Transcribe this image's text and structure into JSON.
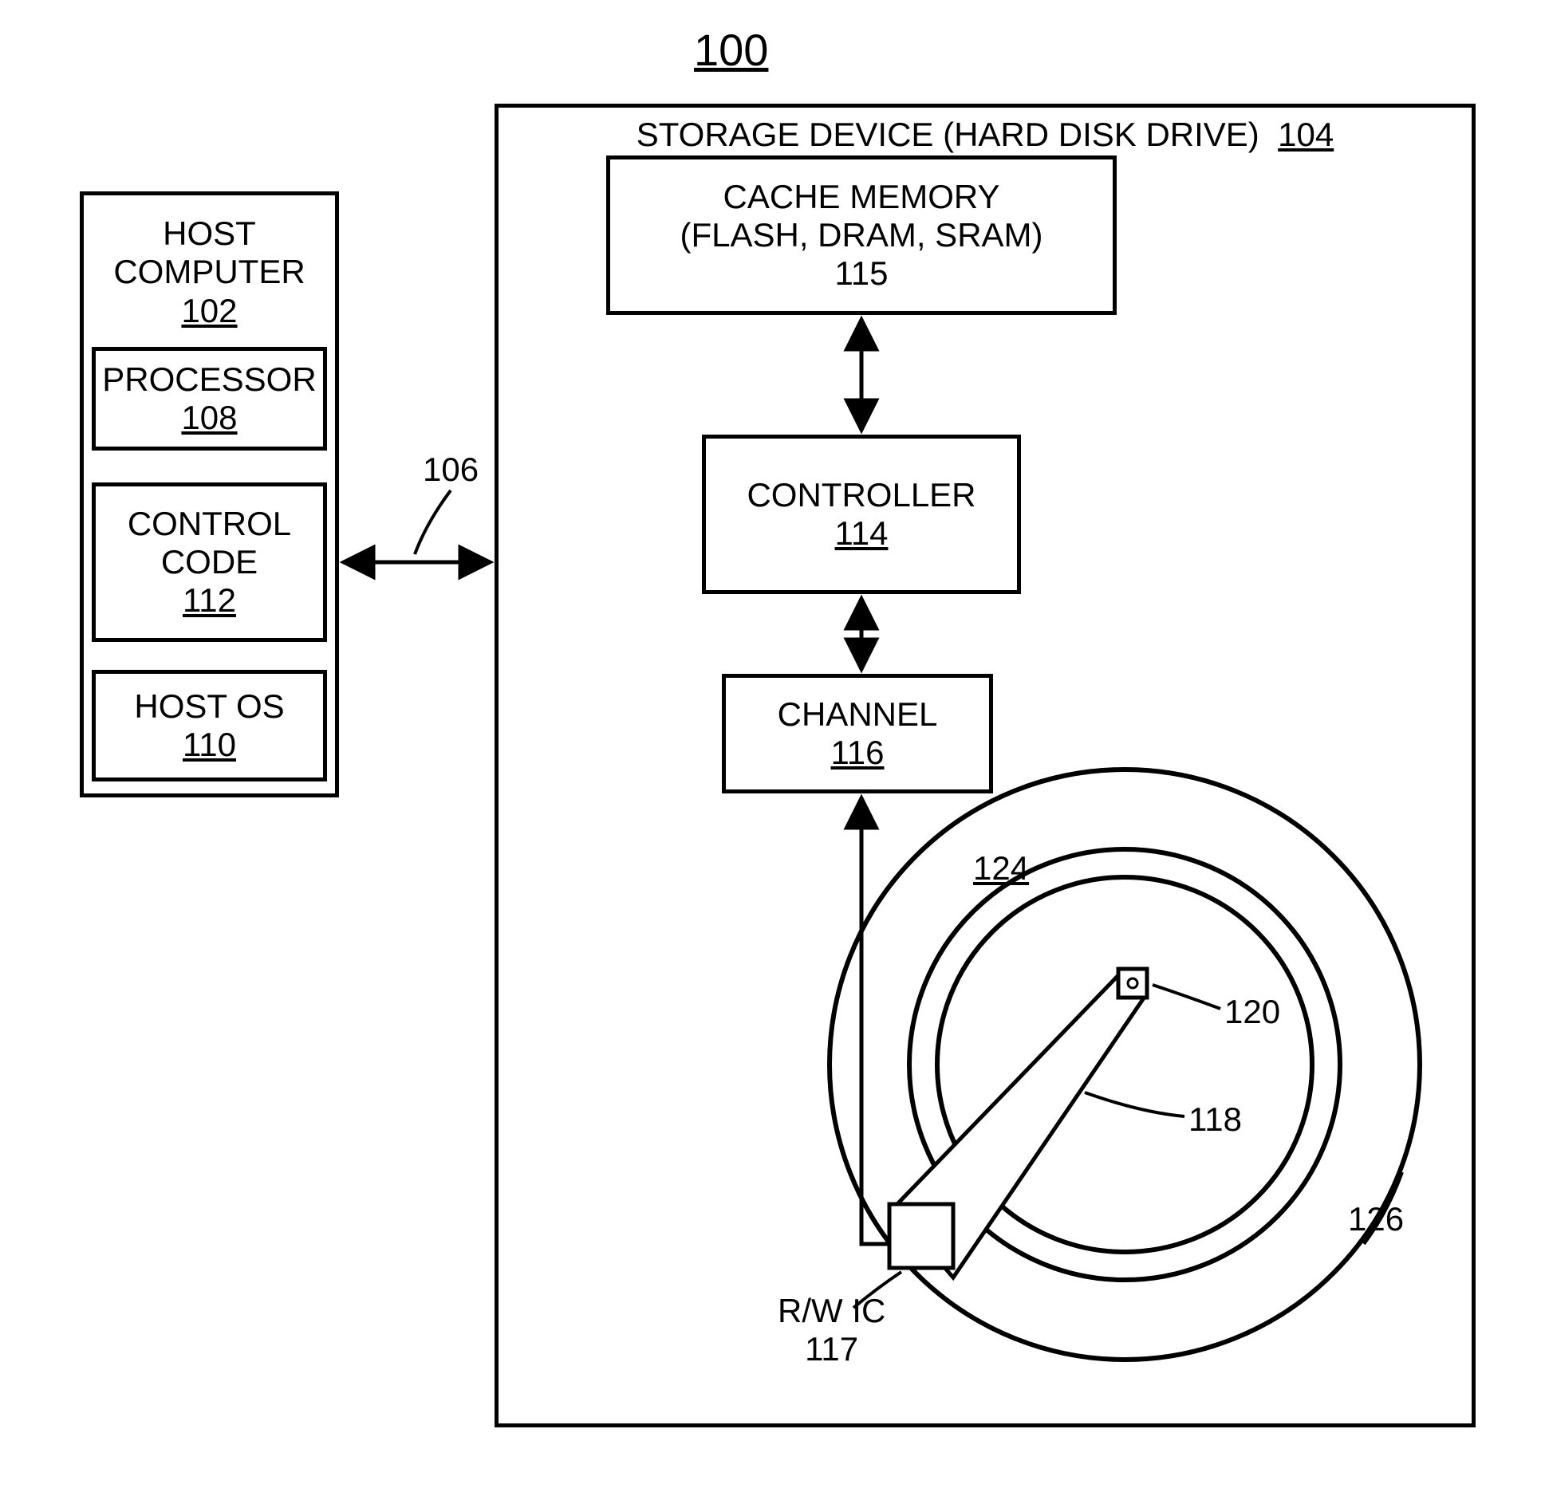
{
  "figure_number": "100",
  "host": {
    "title_line1": "HOST",
    "title_line2": "COMPUTER",
    "ref": "102",
    "processor": {
      "label": "PROCESSOR",
      "ref": "108"
    },
    "control_code": {
      "label_line1": "CONTROL",
      "label_line2": "CODE",
      "ref": "112"
    },
    "host_os": {
      "label": "HOST OS",
      "ref": "110"
    }
  },
  "bus_ref": "106",
  "storage": {
    "title": "STORAGE DEVICE (HARD DISK DRIVE)",
    "ref": "104",
    "cache": {
      "line1": "CACHE MEMORY",
      "line2": "(FLASH, DRAM, SRAM)",
      "ref": "115"
    },
    "controller": {
      "label": "CONTROLLER",
      "ref": "114"
    },
    "channel": {
      "label": "CHANNEL",
      "ref": "116"
    },
    "rw_ic": {
      "label": "R/W IC",
      "ref": "117"
    },
    "platter_inner_ref": "124",
    "head_ref": "120",
    "arm_ref": "118",
    "platter_outer_ref": "126"
  }
}
